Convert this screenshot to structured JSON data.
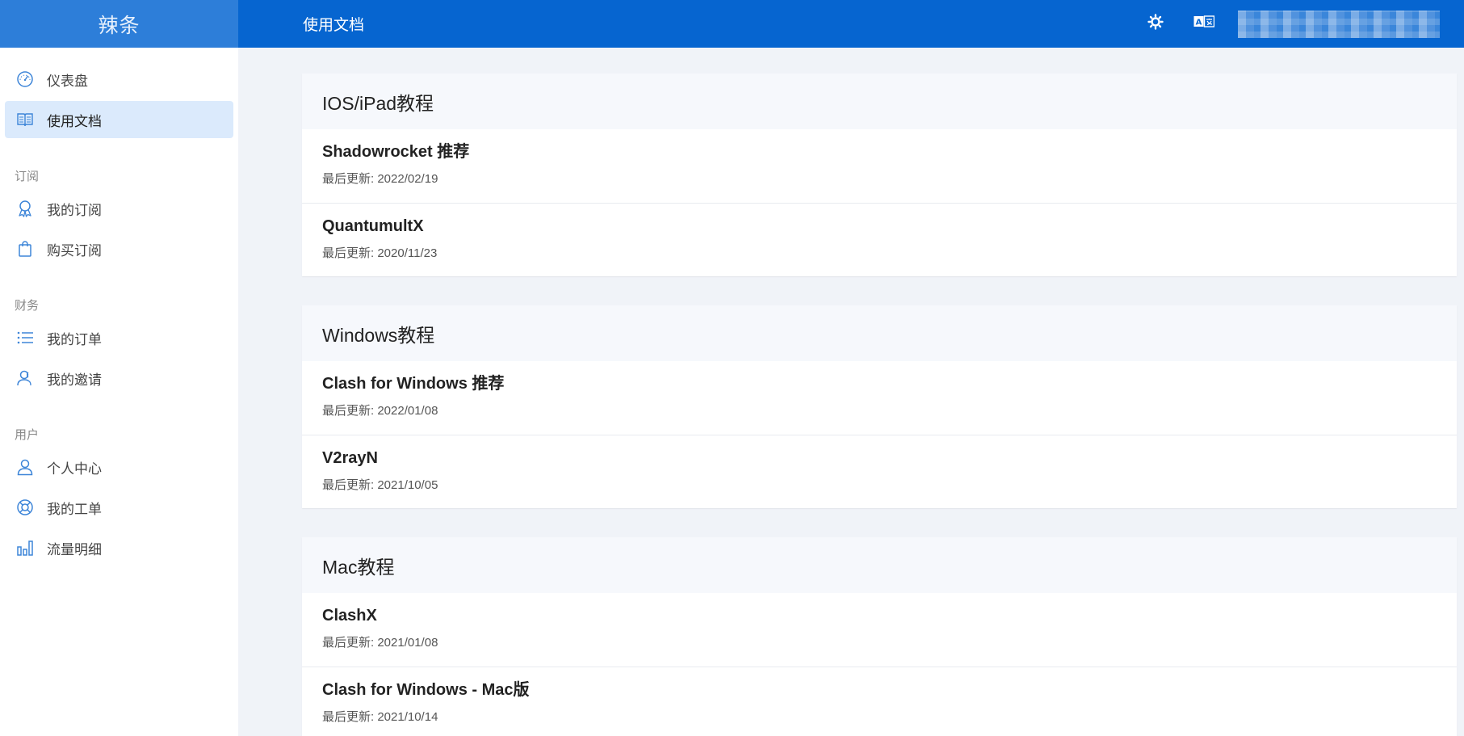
{
  "header": {
    "brand": "辣条",
    "page_title": "使用文档",
    "theme_icon": "sun-icon",
    "language_icon": "translate-icon"
  },
  "sidebar": {
    "items": [
      {
        "label": "仪表盘",
        "icon": "dashboard-icon"
      },
      {
        "label": "使用文档",
        "icon": "book-icon",
        "active": true
      }
    ],
    "sections": [
      {
        "heading": "订阅",
        "items": [
          {
            "label": "我的订阅",
            "icon": "award-icon"
          },
          {
            "label": "购买订阅",
            "icon": "shopping-bag-icon"
          }
        ]
      },
      {
        "heading": "财务",
        "items": [
          {
            "label": "我的订单",
            "icon": "list-icon"
          },
          {
            "label": "我的邀请",
            "icon": "users-icon"
          }
        ]
      },
      {
        "heading": "用户",
        "items": [
          {
            "label": "个人中心",
            "icon": "user-icon"
          },
          {
            "label": "我的工单",
            "icon": "lifebuoy-icon"
          },
          {
            "label": "流量明细",
            "icon": "bar-chart-icon"
          }
        ]
      }
    ]
  },
  "main": {
    "groups": [
      {
        "title": "IOS/iPad教程",
        "docs": [
          {
            "title": "Shadowrocket 推荐",
            "updated": "最后更新: 2022/02/19"
          },
          {
            "title": "QuantumultX",
            "updated": "最后更新: 2020/11/23"
          }
        ]
      },
      {
        "title": "Windows教程",
        "docs": [
          {
            "title": "Clash for Windows 推荐",
            "updated": "最后更新: 2022/01/08"
          },
          {
            "title": "V2rayN",
            "updated": "最后更新: 2021/10/05"
          }
        ]
      },
      {
        "title": "Mac教程",
        "docs": [
          {
            "title": "ClashX",
            "updated": "最后更新: 2021/01/08"
          },
          {
            "title": "Clash for Windows - Mac版",
            "updated": "最后更新: 2021/10/14"
          }
        ]
      }
    ]
  },
  "colors": {
    "header_bg": "#0665d0",
    "brand_bg": "#2d7ed9",
    "active_nav_bg": "#dbeafc",
    "icon_color": "#3d85d8",
    "page_bg": "#f0f3f8"
  }
}
